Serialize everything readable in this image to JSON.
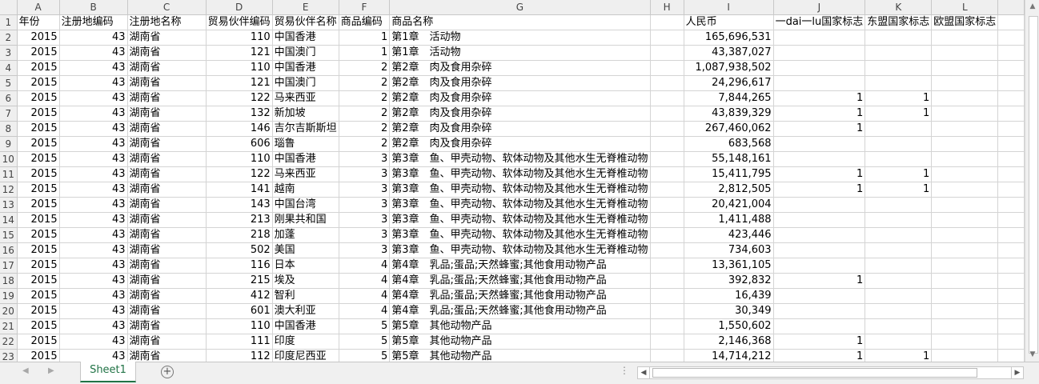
{
  "columns": [
    "A",
    "B",
    "C",
    "D",
    "E",
    "F",
    "G",
    "H",
    "I",
    "J",
    "K",
    "L"
  ],
  "header_row": {
    "num": "1",
    "cells": [
      "年份",
      "注册地编码",
      "注册地名称",
      "贸易伙伴编码",
      "贸易伙伴名称",
      "商品编码",
      "商品名称",
      "",
      "人民币",
      "一dai一lu国家标志",
      "东盟国家标志",
      "欧盟国家标志"
    ]
  },
  "rows": [
    {
      "num": "2",
      "cells": [
        "2015",
        "43",
        "湖南省",
        "110",
        "中国香港",
        "1",
        "第1章　活动物",
        "",
        "165,696,531",
        "",
        "",
        ""
      ]
    },
    {
      "num": "3",
      "cells": [
        "2015",
        "43",
        "湖南省",
        "121",
        "中国澳门",
        "1",
        "第1章　活动物",
        "",
        "43,387,027",
        "",
        "",
        ""
      ]
    },
    {
      "num": "4",
      "cells": [
        "2015",
        "43",
        "湖南省",
        "110",
        "中国香港",
        "2",
        "第2章　肉及食用杂碎",
        "",
        "1,087,938,502",
        "",
        "",
        ""
      ]
    },
    {
      "num": "5",
      "cells": [
        "2015",
        "43",
        "湖南省",
        "121",
        "中国澳门",
        "2",
        "第2章　肉及食用杂碎",
        "",
        "24,296,617",
        "",
        "",
        ""
      ]
    },
    {
      "num": "6",
      "cells": [
        "2015",
        "43",
        "湖南省",
        "122",
        "马来西亚",
        "2",
        "第2章　肉及食用杂碎",
        "",
        "7,844,265",
        "1",
        "1",
        ""
      ]
    },
    {
      "num": "7",
      "cells": [
        "2015",
        "43",
        "湖南省",
        "132",
        "新加坡",
        "2",
        "第2章　肉及食用杂碎",
        "",
        "43,839,329",
        "1",
        "1",
        ""
      ]
    },
    {
      "num": "8",
      "cells": [
        "2015",
        "43",
        "湖南省",
        "146",
        "吉尔吉斯斯坦",
        "2",
        "第2章　肉及食用杂碎",
        "",
        "267,460,062",
        "1",
        "",
        ""
      ]
    },
    {
      "num": "9",
      "cells": [
        "2015",
        "43",
        "湖南省",
        "606",
        "瑙鲁",
        "2",
        "第2章　肉及食用杂碎",
        "",
        "683,568",
        "",
        "",
        ""
      ]
    },
    {
      "num": "10",
      "cells": [
        "2015",
        "43",
        "湖南省",
        "110",
        "中国香港",
        "3",
        "第3章　鱼、甲壳动物、软体动物及其他水生无脊椎动物",
        "",
        "55,148,161",
        "",
        "",
        ""
      ]
    },
    {
      "num": "11",
      "cells": [
        "2015",
        "43",
        "湖南省",
        "122",
        "马来西亚",
        "3",
        "第3章　鱼、甲壳动物、软体动物及其他水生无脊椎动物",
        "",
        "15,411,795",
        "1",
        "1",
        ""
      ]
    },
    {
      "num": "12",
      "cells": [
        "2015",
        "43",
        "湖南省",
        "141",
        "越南",
        "3",
        "第3章　鱼、甲壳动物、软体动物及其他水生无脊椎动物",
        "",
        "2,812,505",
        "1",
        "1",
        ""
      ]
    },
    {
      "num": "13",
      "cells": [
        "2015",
        "43",
        "湖南省",
        "143",
        "中国台湾",
        "3",
        "第3章　鱼、甲壳动物、软体动物及其他水生无脊椎动物",
        "",
        "20,421,004",
        "",
        "",
        ""
      ]
    },
    {
      "num": "14",
      "cells": [
        "2015",
        "43",
        "湖南省",
        "213",
        "刚果共和国",
        "3",
        "第3章　鱼、甲壳动物、软体动物及其他水生无脊椎动物",
        "",
        "1,411,488",
        "",
        "",
        ""
      ]
    },
    {
      "num": "15",
      "cells": [
        "2015",
        "43",
        "湖南省",
        "218",
        "加蓬",
        "3",
        "第3章　鱼、甲壳动物、软体动物及其他水生无脊椎动物",
        "",
        "423,446",
        "",
        "",
        ""
      ]
    },
    {
      "num": "16",
      "cells": [
        "2015",
        "43",
        "湖南省",
        "502",
        "美国",
        "3",
        "第3章　鱼、甲壳动物、软体动物及其他水生无脊椎动物",
        "",
        "734,603",
        "",
        "",
        ""
      ]
    },
    {
      "num": "17",
      "cells": [
        "2015",
        "43",
        "湖南省",
        "116",
        "日本",
        "4",
        "第4章　乳品;蛋品;天然蜂蜜;其他食用动物产品",
        "",
        "13,361,105",
        "",
        "",
        ""
      ]
    },
    {
      "num": "18",
      "cells": [
        "2015",
        "43",
        "湖南省",
        "215",
        "埃及",
        "4",
        "第4章　乳品;蛋品;天然蜂蜜;其他食用动物产品",
        "",
        "392,832",
        "1",
        "",
        ""
      ]
    },
    {
      "num": "19",
      "cells": [
        "2015",
        "43",
        "湖南省",
        "412",
        "智利",
        "4",
        "第4章　乳品;蛋品;天然蜂蜜;其他食用动物产品",
        "",
        "16,439",
        "",
        "",
        ""
      ]
    },
    {
      "num": "20",
      "cells": [
        "2015",
        "43",
        "湖南省",
        "601",
        "澳大利亚",
        "4",
        "第4章　乳品;蛋品;天然蜂蜜;其他食用动物产品",
        "",
        "30,349",
        "",
        "",
        ""
      ]
    },
    {
      "num": "21",
      "cells": [
        "2015",
        "43",
        "湖南省",
        "110",
        "中国香港",
        "5",
        "第5章　其他动物产品",
        "",
        "1,550,602",
        "",
        "",
        ""
      ]
    },
    {
      "num": "22",
      "cells": [
        "2015",
        "43",
        "湖南省",
        "111",
        "印度",
        "5",
        "第5章　其他动物产品",
        "",
        "2,146,368",
        "1",
        "",
        ""
      ]
    },
    {
      "num": "23",
      "cells": [
        "2015",
        "43",
        "湖南省",
        "112",
        "印度尼西亚",
        "5",
        "第5章　其他动物产品",
        "",
        "14,714,212",
        "1",
        "1",
        ""
      ]
    }
  ],
  "sheet_tab": "Sheet1",
  "add_sheet": "+",
  "icons": {
    "scroll_up": "▲",
    "scroll_down": "▼",
    "scroll_left": "◀",
    "scroll_right": "▶",
    "tab_prev": "◀",
    "tab_next": "▶",
    "more": "⋮"
  }
}
